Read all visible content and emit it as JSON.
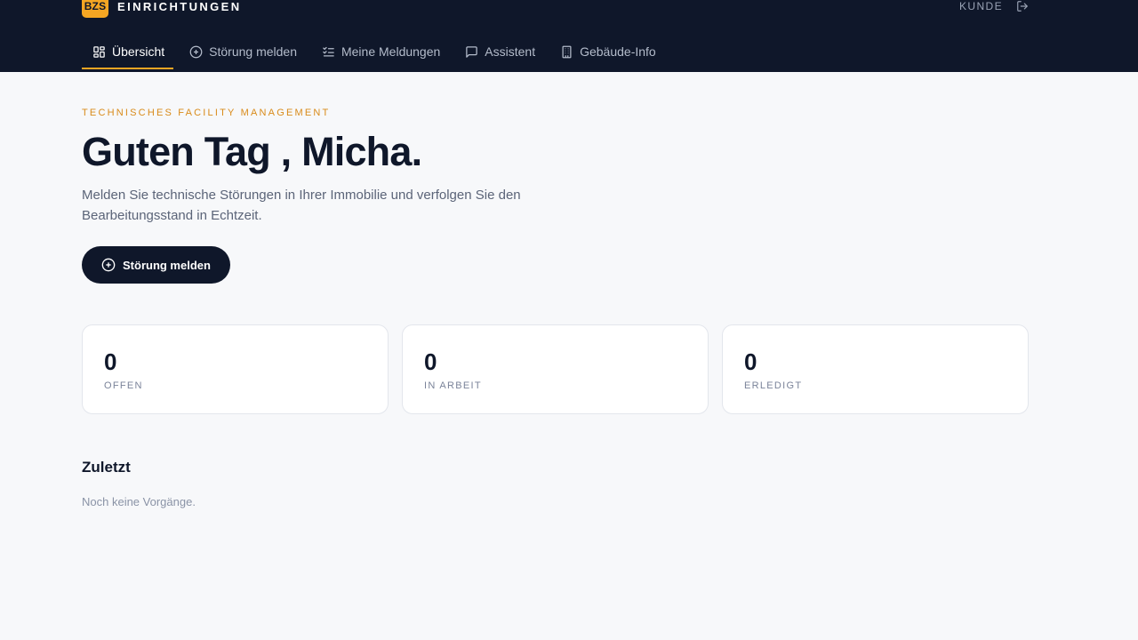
{
  "brand": {
    "badge": "BZS",
    "name": "EINRICHTUNGEN"
  },
  "user": {
    "role": "KUNDE"
  },
  "nav": {
    "items": [
      {
        "label": "Übersicht",
        "icon": "grid-icon",
        "active": true
      },
      {
        "label": "Störung melden",
        "icon": "plus-circle-icon"
      },
      {
        "label": "Meine Meldungen",
        "icon": "checklist-icon"
      },
      {
        "label": "Assistent",
        "icon": "chat-icon"
      },
      {
        "label": "Gebäude-Info",
        "icon": "building-icon"
      }
    ]
  },
  "hero": {
    "eyebrow": "TECHNISCHES FACILITY MANAGEMENT",
    "greeting": "Guten Tag , Micha.",
    "lead": "Melden Sie technische Störungen in Ihrer Immobilie und verfolgen Sie den Bearbeitungsstand in Echtzeit.",
    "cta_label": "Störung melden"
  },
  "stats": [
    {
      "value": "0",
      "label": "OFFEN"
    },
    {
      "value": "0",
      "label": "IN ARBEIT"
    },
    {
      "value": "0",
      "label": "ERLEDIGT"
    }
  ],
  "recent": {
    "title": "Zuletzt",
    "empty": "Noch keine Vorgänge."
  },
  "colors": {
    "navy": "#0f172a",
    "accent": "#f5a623",
    "eyebrow": "#d98b1a"
  }
}
